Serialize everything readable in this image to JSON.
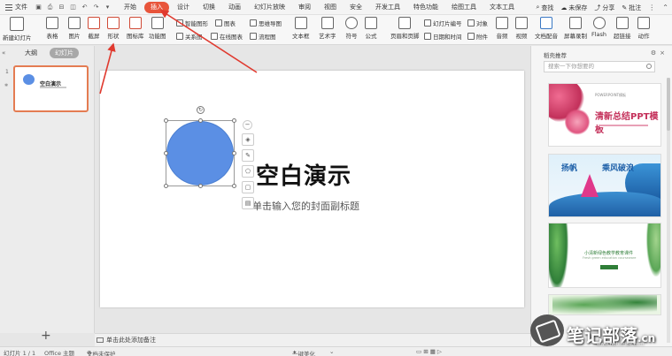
{
  "menu": {
    "file_label": "文件",
    "tabs": [
      "开始",
      "插入",
      "设计",
      "切换",
      "动画",
      "幻灯片放映",
      "审阅",
      "视图",
      "安全",
      "开发工具",
      "特色功能",
      "绘图工具",
      "文本工具"
    ],
    "active_tab": "插入",
    "search_label": "查找",
    "unsaved_label": "未保存",
    "share_label": "分享",
    "comment_label": "批注"
  },
  "ribbon": {
    "new_slide": "新建幻灯片",
    "table": "表格",
    "picture": "图片",
    "screenshot": "截屏",
    "shape": "形状",
    "icon_library": "图标库",
    "function_chart": "功能图",
    "smart_graphic": "智能图形",
    "chart": "图表",
    "relation_chart": "关系图",
    "online_chart": "在线图表",
    "mind_map": "思维导图",
    "flowchart": "流程图",
    "textbox": "文本框",
    "art_text": "艺术字",
    "symbol": "符号",
    "formula": "公式",
    "header_footer": "页眉和页脚",
    "slide_number": "幻灯片编号",
    "date_time": "日期和时间",
    "object": "对象",
    "attachment": "附件",
    "audio": "音频",
    "video": "视频",
    "text_dub": "文档配音",
    "screen_record": "屏幕录制",
    "flash": "Flash",
    "hyperlink": "超链接",
    "action": "动作"
  },
  "left_panel": {
    "tab_outline": "大纲",
    "tab_slides": "幻灯片",
    "slide_number": "1",
    "thumb_title": "空白演示"
  },
  "slide": {
    "title": "空白演示",
    "subtitle": "单击输入您的封面副标题"
  },
  "notes_placeholder": "单击此处添加备注",
  "right_pane": {
    "header": "稻壳推荐",
    "search_placeholder": "搜索一下你想要的",
    "templates": [
      {
        "small": "POWERPOINT模板",
        "title": "清新总结PPT模板"
      },
      {
        "title_a": "扬帆",
        "title_b": "乘风破浪"
      },
      {
        "title": "小清新绿色教学教育课件",
        "sub": "Fresh green education courseware"
      },
      {}
    ]
  },
  "status": {
    "slide_count": "幻灯片 1 / 1",
    "theme": "Office 主题",
    "doc_protect": "文档未保护",
    "beautify": "一键美化"
  },
  "watermark": {
    "text": "笔记部落",
    "url": "www.notetribe.com",
    "suffix": ".cn"
  },
  "colors": {
    "active_tab": "#e8553b",
    "shape_fill": "#5b8fe4",
    "arrow": "#e03a2f"
  }
}
